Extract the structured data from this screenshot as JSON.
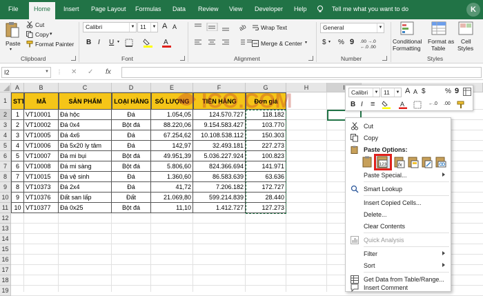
{
  "tabs": [
    "File",
    "Home",
    "Insert",
    "Page Layout",
    "Formulas",
    "Data",
    "Review",
    "View",
    "Developer",
    "Help"
  ],
  "tell_me": "Tell me what you want to do",
  "brand_letter": "K",
  "ribbon": {
    "clipboard": {
      "paste": "Paste",
      "cut": "Cut",
      "copy": "Copy",
      "copy_arrow": "▾",
      "format_painter": "Format Painter",
      "label": "Clipboard"
    },
    "font": {
      "name": "Calibri",
      "size": "11",
      "label": "Font",
      "bold": "B",
      "italic": "I",
      "underline": "U",
      "grow": "A",
      "shrink": "A"
    },
    "alignment": {
      "wrap": "Wrap Text",
      "merge": "Merge & Center",
      "label": "Alignment"
    },
    "number": {
      "format": "General",
      "currency": "$",
      "percent": "%",
      "comma": "9",
      "label": "Number",
      "inc_dec": ".00 →.0",
      "dec_dec": "←.0 .00"
    },
    "styles": {
      "conditional": [
        "Conditional",
        "Formatting"
      ],
      "table": [
        "Format as",
        "Table"
      ],
      "cell": [
        "Cell",
        "Styles"
      ],
      "label": "Styles"
    }
  },
  "formula_bar": {
    "name_box": "I2",
    "cancel": "✕",
    "enter": "✓",
    "fx": "fx",
    "value": ""
  },
  "sheet": {
    "columns": [
      "A",
      "B",
      "C",
      "D",
      "E",
      "F",
      "G",
      "H",
      "I"
    ],
    "row_numbers": [
      "1",
      "2",
      "3",
      "4",
      "5",
      "6",
      "7",
      "8",
      "9",
      "10",
      "11",
      "12",
      "13",
      "14",
      "15",
      "16",
      "17",
      "18",
      "19"
    ],
    "headers": [
      "STT",
      "MÃ",
      "SẢN PHẨM",
      "LOẠI HÀNG",
      "SỐ LƯỢNG",
      "TIỀN HÀNG",
      "Đơn giá"
    ],
    "rows": [
      [
        "1",
        "VT10001",
        "Đá hộc",
        "Đá",
        "1.054,05",
        "124.570.727",
        "118.182"
      ],
      [
        "2",
        "VT10002",
        "Đá 0x4",
        "Bột đá",
        "88.220,06",
        "9.154.583.427",
        "103.770"
      ],
      [
        "3",
        "VT10005",
        "Đá 4x6",
        "Đá",
        "67.254,62",
        "10.108.538.112",
        "150.303"
      ],
      [
        "4",
        "VT10006",
        "Đá 5x20 ly tâm",
        "Đá",
        "142,97",
        "32.493.181",
        "227.273"
      ],
      [
        "5",
        "VT10007",
        "Đá mi bụi",
        "Bột đá",
        "49.951,39",
        "5.036.227.924",
        "100.823"
      ],
      [
        "6",
        "VT10008",
        "Đá mi sàng",
        "Bột đá",
        "5.806,60",
        "824.366.694",
        "141.971"
      ],
      [
        "7",
        "VT10015",
        "Đá vệ sinh",
        "Đá",
        "1.360,60",
        "86.583.639",
        "63.636"
      ],
      [
        "8",
        "VT10373",
        "Đá 2x4",
        "Đá",
        "41,72",
        "7.206.182",
        "172.727"
      ],
      [
        "9",
        "VT10376",
        "Đất san lấp",
        "Đất",
        "21.069,80",
        "599.214.839",
        "28.440"
      ],
      [
        "10",
        "VT10377",
        "Đá 0x25",
        "Bột đá",
        "11,10",
        "1.412.727",
        "127.273"
      ]
    ]
  },
  "mini_toolbar": {
    "font": "Calibri",
    "size": "11",
    "bold": "B",
    "italic": "I",
    "align": "≡",
    "percent": "%",
    "comma": "9",
    "font_color_letter": "A",
    "grow": "A",
    "shrink": "A",
    "dollar": "$",
    "comma_style": ",",
    "dec_up": "←.0",
    "dec_down": ".00"
  },
  "context_menu": {
    "cut": "Cut",
    "copy": "Copy",
    "paste_options": "Paste Options:",
    "paste_values_glyph": "123",
    "paste_formula_glyph": "fx",
    "paste_special": "Paste Special...",
    "smart_lookup": "Smart Lookup",
    "insert_copied": "Insert Copied Cells...",
    "delete": "Delete...",
    "clear": "Clear Contents",
    "quick_analysis": "Quick Analysis",
    "filter": "Filter",
    "sort": "Sort",
    "get_data": "Get Data from Table/Range...",
    "insert_comment": "Insert Comment"
  },
  "watermark": "ICO.COM",
  "colors": {
    "excel_green": "#217346",
    "header_yellow": "#f5c518",
    "highlight_red": "#e0201b"
  }
}
